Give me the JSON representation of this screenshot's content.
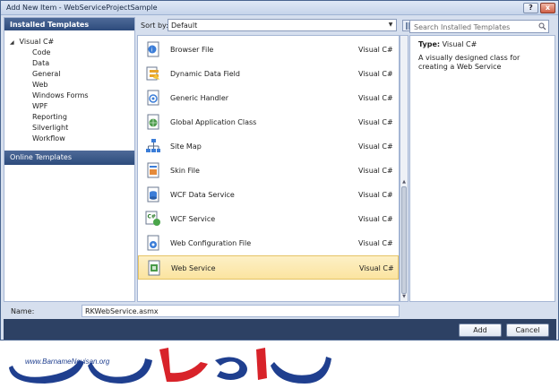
{
  "window": {
    "title": "Add New Item - WebServiceProjectSample",
    "help_label": "?",
    "close_label": "x"
  },
  "left": {
    "header": "Installed Templates",
    "root": "Visual C#",
    "items": [
      "Code",
      "Data",
      "General",
      "Web",
      "Windows Forms",
      "WPF",
      "Reporting",
      "Silverlight",
      "Workflow"
    ],
    "online": "Online Templates"
  },
  "sort": {
    "label": "Sort by:",
    "value": "Default"
  },
  "templates": [
    {
      "name": "Browser File",
      "lang": "Visual C#",
      "icon": "browser-file-icon"
    },
    {
      "name": "Dynamic Data Field",
      "lang": "Visual C#",
      "icon": "dynamic-data-field-icon"
    },
    {
      "name": "Generic Handler",
      "lang": "Visual C#",
      "icon": "generic-handler-icon"
    },
    {
      "name": "Global Application Class",
      "lang": "Visual C#",
      "icon": "global-application-class-icon"
    },
    {
      "name": "Site Map",
      "lang": "Visual C#",
      "icon": "site-map-icon"
    },
    {
      "name": "Skin File",
      "lang": "Visual C#",
      "icon": "skin-file-icon"
    },
    {
      "name": "WCF Data Service",
      "lang": "Visual C#",
      "icon": "wcf-data-service-icon"
    },
    {
      "name": "WCF Service",
      "lang": "Visual C#",
      "icon": "wcf-service-icon"
    },
    {
      "name": "Web Configuration File",
      "lang": "Visual C#",
      "icon": "web-config-icon"
    },
    {
      "name": "Web Service",
      "lang": "Visual C#",
      "icon": "web-service-icon"
    }
  ],
  "search": {
    "placeholder": "Search Installed Templates"
  },
  "details": {
    "type_label": "Type:",
    "type_value": "Visual C#",
    "description": "A visually designed class for creating a Web Service"
  },
  "name_field": {
    "label": "Name:",
    "value": "RKWebService.asmx"
  },
  "buttons": {
    "add": "Add",
    "cancel": "Cancel"
  },
  "watermark": {
    "url": "www.BarnameNevisan.org"
  }
}
